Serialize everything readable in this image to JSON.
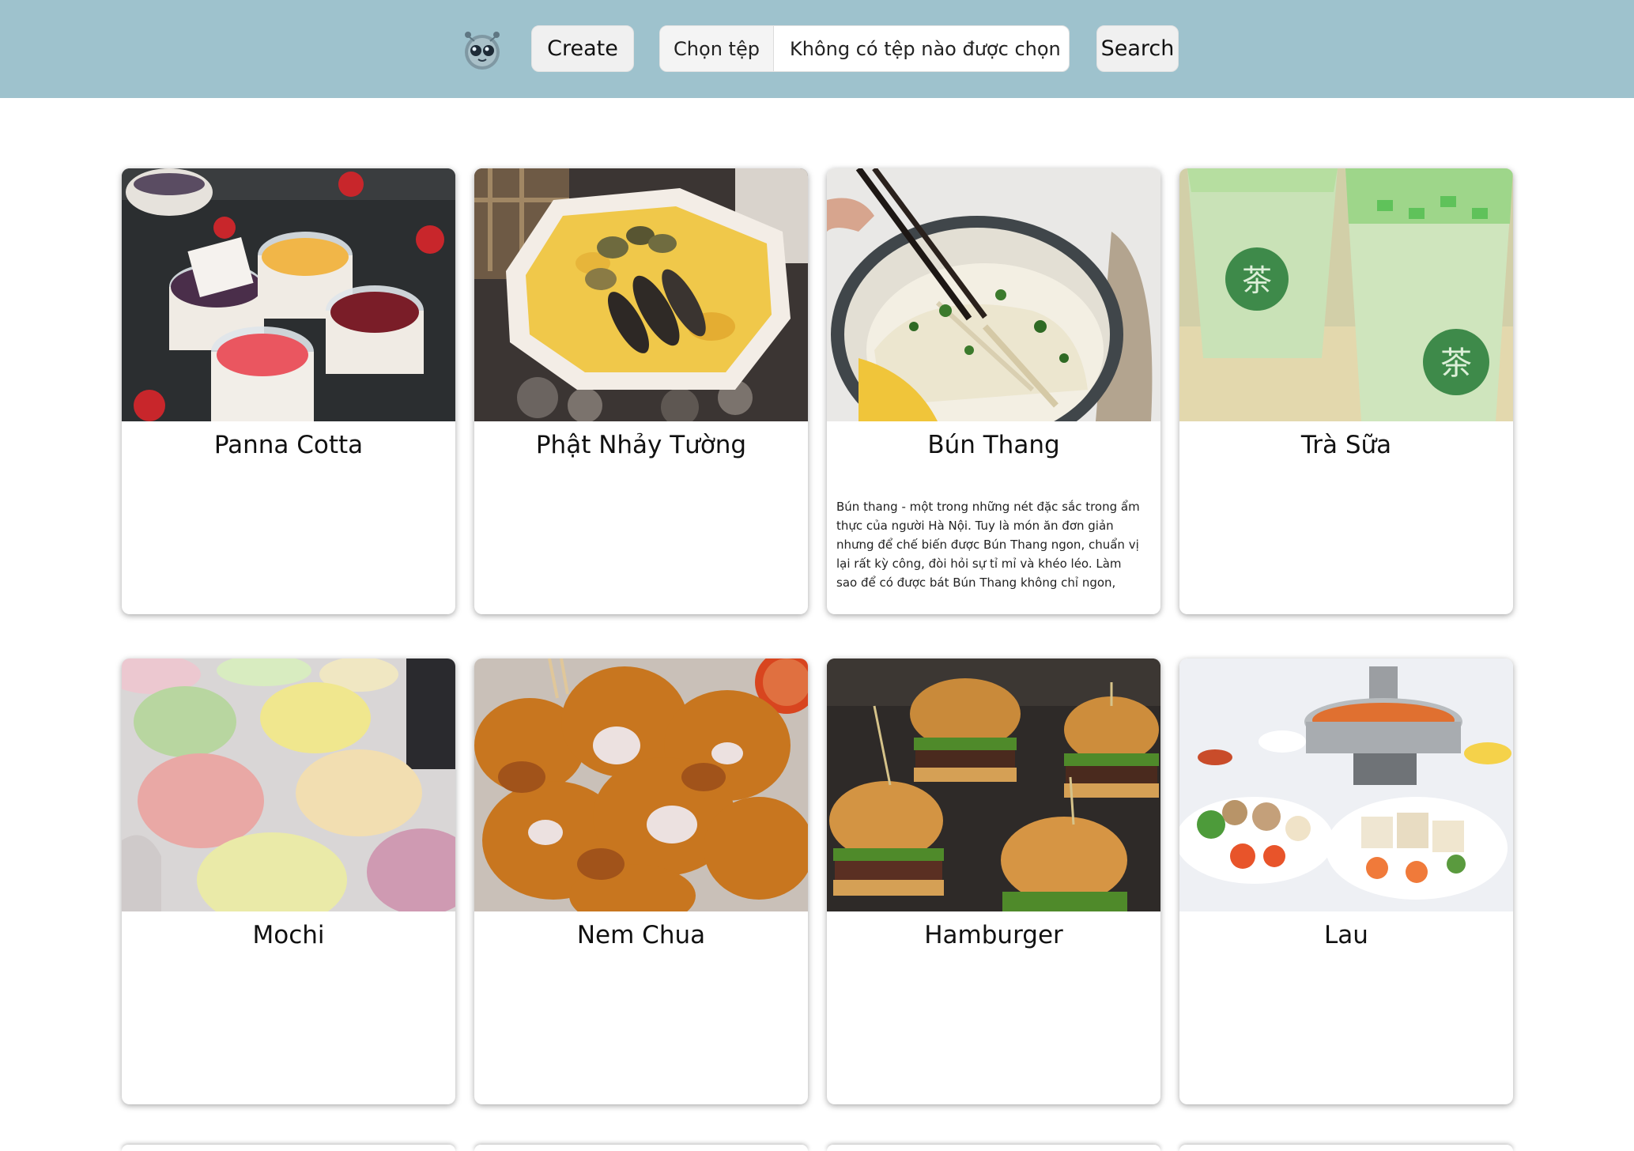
{
  "header": {
    "create_label": "Create",
    "file_choose_label": "Chọn tệp",
    "file_status": "Không có tệp nào được chọn",
    "search_label": "Search"
  },
  "cards": [
    {
      "title": "Panna Cotta",
      "description": "",
      "image": "panna-cotta-photo"
    },
    {
      "title": "Phật Nhảy Tường",
      "description": "",
      "image": "phat-nhay-tuong-photo"
    },
    {
      "title": "Bún Thang",
      "description": "Bún thang - một trong những nét đặc sắc trong ẩm thực của người Hà Nội. Tuy là món ăn đơn giản nhưng để chế biến được Bún Thang ngon, chuẩn vị lại rất kỳ công, đòi hỏi sự tỉ mỉ và khéo léo. Làm sao để có được bát Bún Thang không chỉ ngon, nước dùng trong vắt, đậm đà, ngọt thanh mà cách bày biện cũng cần đẹp",
      "image": "bun-thang-photo"
    },
    {
      "title": "Trà Sữa",
      "description": "",
      "image": "tra-sua-photo"
    },
    {
      "title": "Mochi",
      "description": "",
      "image": "mochi-photo"
    },
    {
      "title": "Nem Chua",
      "description": "",
      "image": "nem-chua-photo"
    },
    {
      "title": "Hamburger",
      "description": "",
      "image": "hamburger-photo"
    },
    {
      "title": "Lau",
      "description": "",
      "image": "lau-photo"
    }
  ],
  "colors": {
    "header_bg": "#9ec2cd",
    "button_bg": "#f0f0f0",
    "card_bg": "#ffffff"
  }
}
